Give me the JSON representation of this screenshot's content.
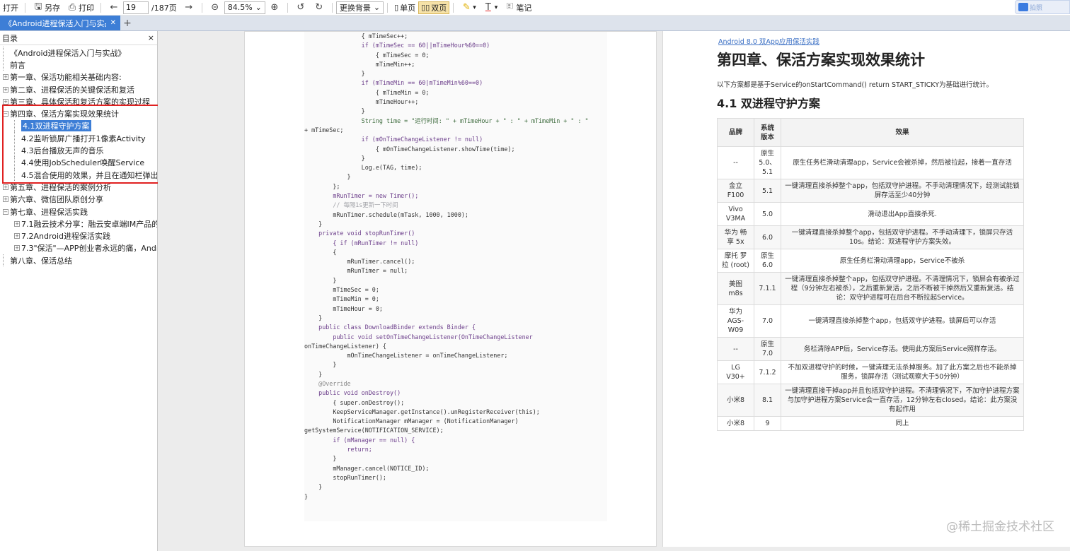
{
  "toolbar": {
    "open": "打开",
    "save_as": "另存",
    "print": "打印",
    "page_current": "19",
    "page_total": "/187页",
    "zoom": "84.5%",
    "background": "更换背景",
    "single_page": "单页",
    "double_page": "双页",
    "notes": "笔记",
    "badge": "拍照"
  },
  "tab": {
    "label": "《Android进程保活入门与实战》",
    "add": "+"
  },
  "sidebar": {
    "title": "目录",
    "close": "×",
    "items": [
      {
        "label": "《Android进程保活入门与实战》",
        "level": 0,
        "expander": "none"
      },
      {
        "label": "前言",
        "level": 0,
        "expander": "none"
      },
      {
        "label": "第一章、保活功能相关基础内容:",
        "level": 0,
        "expander": "plus"
      },
      {
        "label": "第二章、进程保活的关键保活和复活",
        "level": 0,
        "expander": "plus"
      },
      {
        "label": "第三章、具体保活和复活方案的实现过程",
        "level": 0,
        "expander": "plus"
      },
      {
        "label": "第四章、保活方案实现效果统计",
        "level": 0,
        "expander": "minus"
      },
      {
        "label": "4.1双进程守护方案",
        "level": 1,
        "expander": "none",
        "selected": true
      },
      {
        "label": "4.2监听锁屏广播打开1像素Activity",
        "level": 1,
        "expander": "none"
      },
      {
        "label": "4.3后台播放无声的音乐",
        "level": 1,
        "expander": "none"
      },
      {
        "label": "4.4使用JobScheduler唤醒Service",
        "level": 1,
        "expander": "none"
      },
      {
        "label": "4.5混合使用的效果，并且在通知栏弹出通",
        "level": 1,
        "expander": "none"
      },
      {
        "label": "第五章、进程保活的案例分析",
        "level": 0,
        "expander": "plus"
      },
      {
        "label": "第六章、微信团队原创分享",
        "level": 0,
        "expander": "plus"
      },
      {
        "label": "第七章、进程保活实践",
        "level": 0,
        "expander": "minus"
      },
      {
        "label": "7.1融云技术分享：融云安卓端IM产品的网",
        "level": 1,
        "expander": "plus"
      },
      {
        "label": "7.2Android进程保活实践",
        "level": 1,
        "expander": "plus"
      },
      {
        "label": "7.3\"保活\"—APP创业者永远的痛，Andro",
        "level": 1,
        "expander": "plus"
      },
      {
        "label": "第八章、保活总结",
        "level": 0,
        "expander": "none"
      }
    ]
  },
  "code_lines": [
    "                { mTimeSec++;",
    "                if (mTimeSec == 60||mTimeHour%60==0)",
    "                    { mTimeSec = 0;",
    "                    mTimeMin++;",
    "                }",
    "                if (mTimeMin == 60|mTimeMin%60==0)",
    "                    { mTimeMin = 0;",
    "                    mTimeHour++;",
    "                }",
    "",
    "                String time = \"运行时间: \" + mTimeHour + \" : \" + mTimeMin + \" : \"",
    "+ mTimeSec;",
    "                if (mOnTimeChangeListener != null)",
    "                    { mOnTimeChangeListener.showTime(time);",
    "                }",
    "                Log.e(TAG, time);",
    "            }",
    "        };",
    "        mRunTimer = new Timer();",
    "        // 每隔1s更新一下时间",
    "        mRunTimer.schedule(mTask, 1000, 1000);",
    "    }",
    "",
    "    private void stopRunTimer()",
    "        { if (mRunTimer != null)",
    "        {",
    "            mRunTimer.cancel();",
    "            mRunTimer = null;",
    "        }",
    "        mTimeSec = 0;",
    "        mTimeMin = 0;",
    "        mTimeHour = 0;",
    "    }",
    "",
    "    public class DownloadBinder extends Binder {",
    "        public void setOnTimeChangeListener(OnTimeChangeListener",
    "onTimeChangeListener) {",
    "            mOnTimeChangeListener = onTimeChangeListener;",
    "        }",
    "    }",
    "",
    "    @Override",
    "    public void onDestroy()",
    "        { super.onDestroy();",
    "        KeepServiceManager.getInstance().unRegisterReceiver(this);",
    "        NotificationManager mManager = (NotificationManager)",
    "getSystemService(NOTIFICATION_SERVICE);",
    "        if (mManager == null) {",
    "            return;",
    "        }",
    "        mManager.cancel(NOTICE_ID);",
    "        stopRunTimer();",
    "    }",
    "}"
  ],
  "right_page": {
    "link": "Android 8.0 双App应用保活实践",
    "h1": "第四章、保活方案实现效果统计",
    "intro": "以下方案都是基于Service的onStartCommand() return START_STICKY为基础进行统计。",
    "h2": "4.1 双进程守护方案",
    "table": {
      "headers": [
        "品牌",
        "系统版本",
        "效果"
      ],
      "rows": [
        [
          "--",
          "原生 5.0、5.1",
          "原生任务栏滑动清理app，Service会被杀掉，然后被拉起，接着一直存活"
        ],
        [
          "金立 F100",
          "5.1",
          "一键清理直接杀掉整个app，包括双守护进程。不手动清理情况下，经测试能锁屏存活至少40分钟"
        ],
        [
          "Vivo V3MA",
          "5.0",
          "滑动退出App直接杀死."
        ],
        [
          "华为 畅享 5x",
          "6.0",
          "一键清理直接杀掉整个app，包括双守护进程。不手动清理下，锁屏只存活10s。结论：双进程守护方案失效。"
        ],
        [
          "摩托 罗拉 (root)",
          "原生 6.0",
          "原生任务栏滑动清理app，Service不被杀"
        ],
        [
          "美图 m8s",
          "7.1.1",
          "一键清理直接杀掉整个app，包括双守护进程。不清理情况下，锁屏会有被杀过程（9分钟左右被杀），之后重新复活，之后不断被干掉然后又重新复活。结论：双守护进程可在后台不断拉起Service。"
        ],
        [
          "华为 AGS-W09",
          "7.0",
          "一键清理直接杀掉整个app，包括双守护进程。锁屏后可以存活"
        ],
        [
          "--",
          "原生 7.0",
          "务栏清除APP后，Service存活。使用此方案后Service照样存活。"
        ],
        [
          "LG V30+",
          "7.1.2",
          "不加双进程守护的时候，一键清理无法杀掉服务。加了此方案之后也不能杀掉服务，锁屏存活（测试观察大于50分钟）"
        ],
        [
          "小米8",
          "8.1",
          "一键清理直接干掉app并且包括双守护进程。不清理情况下，不加守护进程方案与加守护进程方案Service会一直存活，12分钟左右closed。结论：此方案没有起作用"
        ],
        [
          "小米8",
          "9",
          "同上"
        ]
      ]
    }
  },
  "watermark": "@稀土掘金技术社区"
}
